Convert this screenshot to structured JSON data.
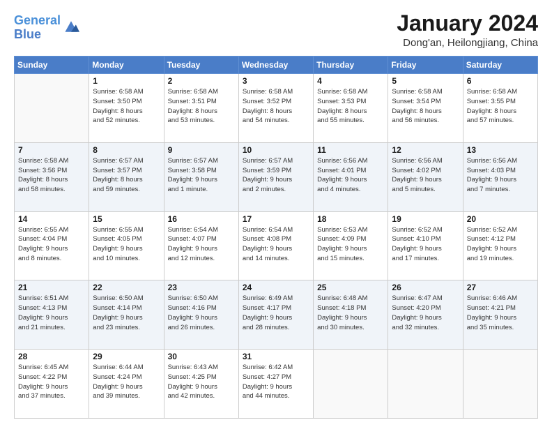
{
  "header": {
    "logo_line1": "General",
    "logo_line2": "Blue",
    "title": "January 2024",
    "location": "Dong'an, Heilongjiang, China"
  },
  "weekdays": [
    "Sunday",
    "Monday",
    "Tuesday",
    "Wednesday",
    "Thursday",
    "Friday",
    "Saturday"
  ],
  "weeks": [
    [
      {
        "day": "",
        "info": ""
      },
      {
        "day": "1",
        "info": "Sunrise: 6:58 AM\nSunset: 3:50 PM\nDaylight: 8 hours\nand 52 minutes."
      },
      {
        "day": "2",
        "info": "Sunrise: 6:58 AM\nSunset: 3:51 PM\nDaylight: 8 hours\nand 53 minutes."
      },
      {
        "day": "3",
        "info": "Sunrise: 6:58 AM\nSunset: 3:52 PM\nDaylight: 8 hours\nand 54 minutes."
      },
      {
        "day": "4",
        "info": "Sunrise: 6:58 AM\nSunset: 3:53 PM\nDaylight: 8 hours\nand 55 minutes."
      },
      {
        "day": "5",
        "info": "Sunrise: 6:58 AM\nSunset: 3:54 PM\nDaylight: 8 hours\nand 56 minutes."
      },
      {
        "day": "6",
        "info": "Sunrise: 6:58 AM\nSunset: 3:55 PM\nDaylight: 8 hours\nand 57 minutes."
      }
    ],
    [
      {
        "day": "7",
        "info": "Sunrise: 6:58 AM\nSunset: 3:56 PM\nDaylight: 8 hours\nand 58 minutes."
      },
      {
        "day": "8",
        "info": "Sunrise: 6:57 AM\nSunset: 3:57 PM\nDaylight: 8 hours\nand 59 minutes."
      },
      {
        "day": "9",
        "info": "Sunrise: 6:57 AM\nSunset: 3:58 PM\nDaylight: 9 hours\nand 1 minute."
      },
      {
        "day": "10",
        "info": "Sunrise: 6:57 AM\nSunset: 3:59 PM\nDaylight: 9 hours\nand 2 minutes."
      },
      {
        "day": "11",
        "info": "Sunrise: 6:56 AM\nSunset: 4:01 PM\nDaylight: 9 hours\nand 4 minutes."
      },
      {
        "day": "12",
        "info": "Sunrise: 6:56 AM\nSunset: 4:02 PM\nDaylight: 9 hours\nand 5 minutes."
      },
      {
        "day": "13",
        "info": "Sunrise: 6:56 AM\nSunset: 4:03 PM\nDaylight: 9 hours\nand 7 minutes."
      }
    ],
    [
      {
        "day": "14",
        "info": "Sunrise: 6:55 AM\nSunset: 4:04 PM\nDaylight: 9 hours\nand 8 minutes."
      },
      {
        "day": "15",
        "info": "Sunrise: 6:55 AM\nSunset: 4:05 PM\nDaylight: 9 hours\nand 10 minutes."
      },
      {
        "day": "16",
        "info": "Sunrise: 6:54 AM\nSunset: 4:07 PM\nDaylight: 9 hours\nand 12 minutes."
      },
      {
        "day": "17",
        "info": "Sunrise: 6:54 AM\nSunset: 4:08 PM\nDaylight: 9 hours\nand 14 minutes."
      },
      {
        "day": "18",
        "info": "Sunrise: 6:53 AM\nSunset: 4:09 PM\nDaylight: 9 hours\nand 15 minutes."
      },
      {
        "day": "19",
        "info": "Sunrise: 6:52 AM\nSunset: 4:10 PM\nDaylight: 9 hours\nand 17 minutes."
      },
      {
        "day": "20",
        "info": "Sunrise: 6:52 AM\nSunset: 4:12 PM\nDaylight: 9 hours\nand 19 minutes."
      }
    ],
    [
      {
        "day": "21",
        "info": "Sunrise: 6:51 AM\nSunset: 4:13 PM\nDaylight: 9 hours\nand 21 minutes."
      },
      {
        "day": "22",
        "info": "Sunrise: 6:50 AM\nSunset: 4:14 PM\nDaylight: 9 hours\nand 23 minutes."
      },
      {
        "day": "23",
        "info": "Sunrise: 6:50 AM\nSunset: 4:16 PM\nDaylight: 9 hours\nand 26 minutes."
      },
      {
        "day": "24",
        "info": "Sunrise: 6:49 AM\nSunset: 4:17 PM\nDaylight: 9 hours\nand 28 minutes."
      },
      {
        "day": "25",
        "info": "Sunrise: 6:48 AM\nSunset: 4:18 PM\nDaylight: 9 hours\nand 30 minutes."
      },
      {
        "day": "26",
        "info": "Sunrise: 6:47 AM\nSunset: 4:20 PM\nDaylight: 9 hours\nand 32 minutes."
      },
      {
        "day": "27",
        "info": "Sunrise: 6:46 AM\nSunset: 4:21 PM\nDaylight: 9 hours\nand 35 minutes."
      }
    ],
    [
      {
        "day": "28",
        "info": "Sunrise: 6:45 AM\nSunset: 4:22 PM\nDaylight: 9 hours\nand 37 minutes."
      },
      {
        "day": "29",
        "info": "Sunrise: 6:44 AM\nSunset: 4:24 PM\nDaylight: 9 hours\nand 39 minutes."
      },
      {
        "day": "30",
        "info": "Sunrise: 6:43 AM\nSunset: 4:25 PM\nDaylight: 9 hours\nand 42 minutes."
      },
      {
        "day": "31",
        "info": "Sunrise: 6:42 AM\nSunset: 4:27 PM\nDaylight: 9 hours\nand 44 minutes."
      },
      {
        "day": "",
        "info": ""
      },
      {
        "day": "",
        "info": ""
      },
      {
        "day": "",
        "info": ""
      }
    ]
  ]
}
